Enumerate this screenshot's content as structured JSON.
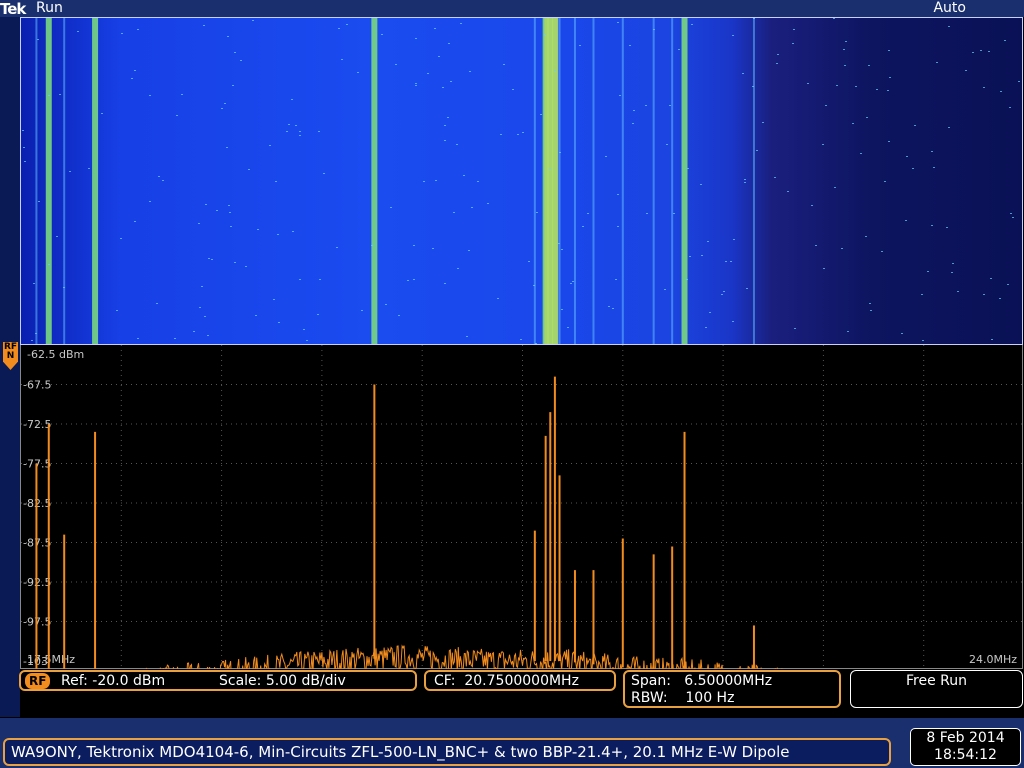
{
  "header": {
    "brand": "Tek",
    "run_state": "Run",
    "trigger_mode": "Auto"
  },
  "rf_marker": {
    "line1": "RF",
    "line2": "N"
  },
  "spectrum": {
    "ref_top_label": "-62.5 dBm",
    "y_labels": [
      "-67.5",
      "-72.5",
      "-77.5",
      "-82.5",
      "-87.5",
      "-92.5",
      "-97.5",
      "-103"
    ],
    "start_freq": "17.5MHz",
    "stop_freq": "24.0MHz"
  },
  "readouts": {
    "rf_tag": "RF",
    "ref": "Ref: -20.0 dBm",
    "scale": "Scale: 5.00 dB/div",
    "cf": "CF:  20.7500000MHz",
    "span": "Span:   6.50000MHz",
    "rbw": "RBW:    100 Hz",
    "free_run": "Free Run"
  },
  "footer": {
    "note": "WA9ONY, Tektronix MDO4104-6, Min-Circuits ZFL-500-LN_BNC+ & two BBP-21.4+, 20.1 MHz E-W Dipole",
    "date": "8 Feb  2014",
    "time": "18:54:12"
  },
  "chart_data": {
    "type": "line",
    "title": "",
    "xlabel": "",
    "ylabel": "",
    "x_unit": "MHz",
    "y_unit": "dBm",
    "xlim": [
      17.5,
      24.0
    ],
    "ylim": [
      -102.5,
      -62.5
    ],
    "noise_floor": [
      [
        17.5,
        -105.5
      ],
      [
        18.0,
        -105.5
      ],
      [
        18.5,
        -104.5
      ],
      [
        19.0,
        -103.5
      ],
      [
        19.5,
        -102.5
      ],
      [
        20.0,
        -102.0
      ],
      [
        20.5,
        -102.5
      ],
      [
        21.0,
        -102.5
      ],
      [
        21.5,
        -103.5
      ],
      [
        22.0,
        -104.0
      ],
      [
        22.5,
        -105.0
      ],
      [
        23.0,
        -106.0
      ],
      [
        23.5,
        -106.5
      ],
      [
        24.0,
        -106.5
      ]
    ],
    "peaks": [
      {
        "x": 17.6,
        "y": -77.5
      },
      {
        "x": 17.68,
        "y": -72.5
      },
      {
        "x": 17.78,
        "y": -86.5
      },
      {
        "x": 17.98,
        "y": -73.5
      },
      {
        "x": 19.79,
        "y": -67.5
      },
      {
        "x": 20.83,
        "y": -86.0
      },
      {
        "x": 20.9,
        "y": -74.0
      },
      {
        "x": 20.93,
        "y": -71.0
      },
      {
        "x": 20.96,
        "y": -66.5
      },
      {
        "x": 20.99,
        "y": -79.0
      },
      {
        "x": 21.09,
        "y": -91.0
      },
      {
        "x": 21.21,
        "y": -91.0
      },
      {
        "x": 21.4,
        "y": -87.0
      },
      {
        "x": 21.6,
        "y": -89.0
      },
      {
        "x": 21.72,
        "y": -88.0
      },
      {
        "x": 21.8,
        "y": -73.5
      },
      {
        "x": 22.25,
        "y": -98.0
      }
    ]
  },
  "colors": {
    "trace": "#f28c1e",
    "accent": "#e8a040",
    "bar": "#1a2f6e"
  }
}
